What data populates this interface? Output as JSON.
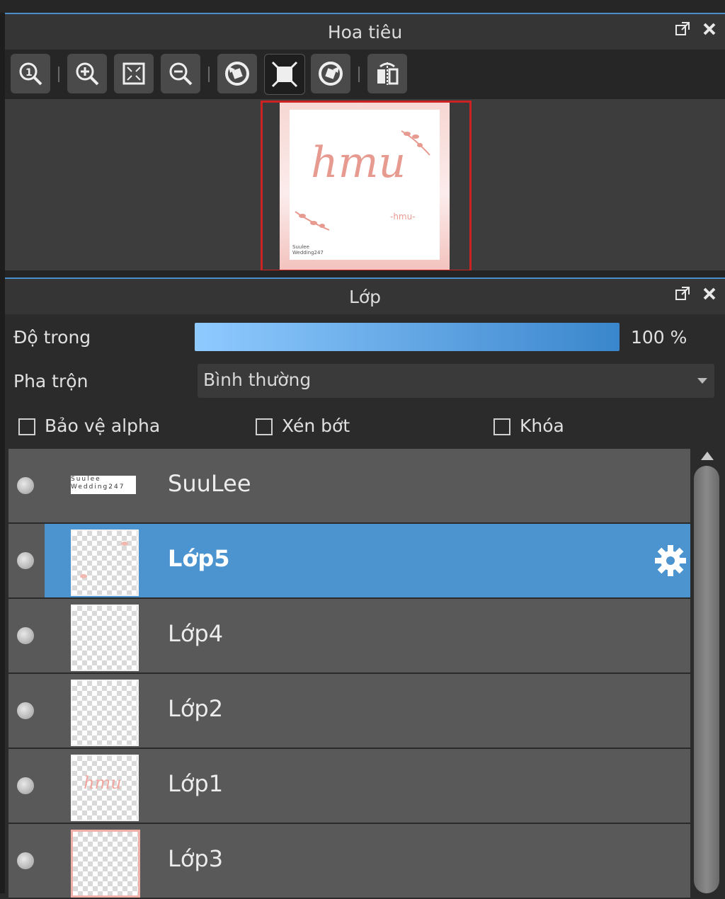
{
  "navigator": {
    "title": "Hoa tiêu",
    "preview_text": "hmu",
    "preview_small_text": "-hmu-",
    "preview_credit": [
      "Suulee",
      "Wedding247"
    ]
  },
  "layers_panel": {
    "title": "Lớp",
    "opacity_label": "Độ trong",
    "opacity_value": "100 %",
    "opacity_fraction": 1.0,
    "blend_label": "Pha trộn",
    "blend_value": "Bình thường",
    "protect_alpha_label": "Bảo vệ alpha",
    "clipping_label": "Xén bớt",
    "lock_label": "Khóa",
    "layers": [
      {
        "name": "SuuLee",
        "selected": false
      },
      {
        "name": "Lớp5",
        "selected": true
      },
      {
        "name": "Lớp4",
        "selected": false
      },
      {
        "name": "Lớp2",
        "selected": false
      },
      {
        "name": "Lớp1",
        "selected": false
      },
      {
        "name": "Lớp3",
        "selected": false
      }
    ]
  },
  "colors": {
    "accent": "#4b94d0",
    "preview_border": "#cc2222",
    "ink": "#e79a90"
  }
}
